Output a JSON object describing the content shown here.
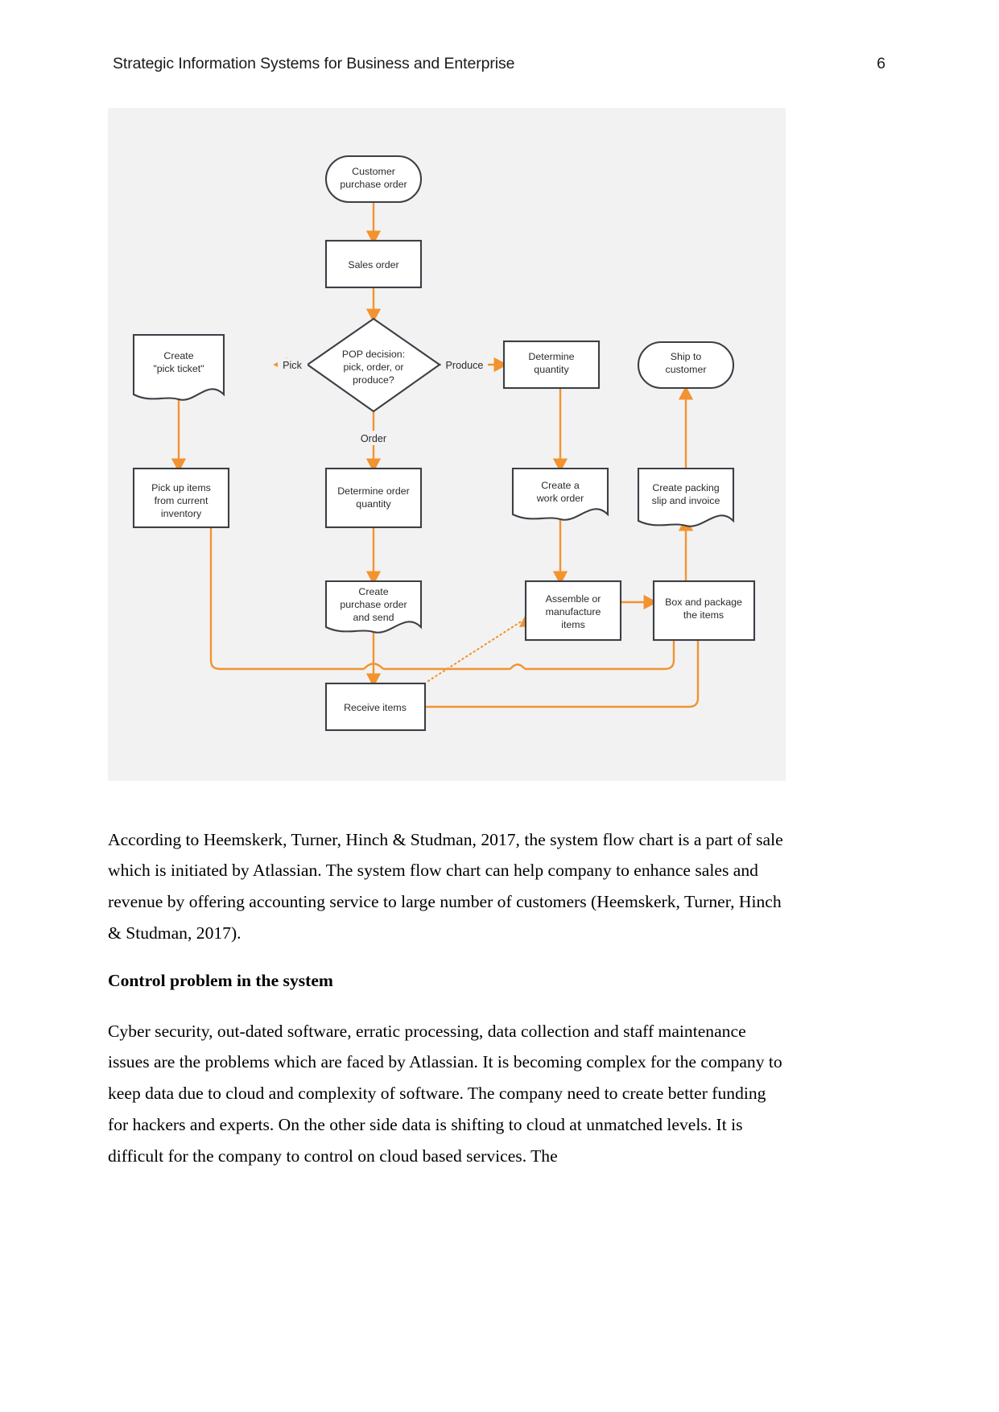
{
  "header": {
    "title": "Strategic Information Systems for Business and Enterprise",
    "page_number": "6"
  },
  "figure": {
    "name": "system-flow-chart",
    "background_color": "#f2f2f2",
    "accent_color": "#f29330",
    "shape_stroke_color": "#3c3f46"
  },
  "chart_data": {
    "type": "diagram",
    "diagram_kind": "flowchart",
    "title": "",
    "nodes": [
      {
        "id": "customer_purchase_order",
        "label": "Customer\npurchase order",
        "line1": "Customer",
        "line2": "purchase order",
        "shape": "terminator"
      },
      {
        "id": "sales_order",
        "label": "Sales order",
        "line1": "Sales order",
        "shape": "process"
      },
      {
        "id": "pop_decision",
        "label": "POP decision:\npick, order, or\nproduce?",
        "line1": "POP decision:",
        "line2": "pick, order, or",
        "line3": "produce?",
        "shape": "decision"
      },
      {
        "id": "create_pick_ticket",
        "label": "Create\n\"pick ticket\"",
        "line1": "Create",
        "line2": "\"pick ticket\"",
        "shape": "document"
      },
      {
        "id": "determine_quantity",
        "label": "Determine\nquantity",
        "line1": "Determine",
        "line2": "quantity",
        "shape": "process"
      },
      {
        "id": "ship_to_customer",
        "label": "Ship to\ncustomer",
        "line1": "Ship to",
        "line2": "customer",
        "shape": "terminator"
      },
      {
        "id": "pick_up_items",
        "label": "Pick up items\nfrom current\ninventory",
        "line1": "Pick up items",
        "line2": "from current",
        "line3": "inventory",
        "shape": "process"
      },
      {
        "id": "determine_order_quantity",
        "label": "Determine order\nquantity",
        "line1": "Determine order",
        "line2": "quantity",
        "shape": "process"
      },
      {
        "id": "create_work_order",
        "label": "Create a\nwork order",
        "line1": "Create a",
        "line2": "work order",
        "shape": "document"
      },
      {
        "id": "create_packing_slip",
        "label": "Create packing\nslip and invoice",
        "line1": "Create packing",
        "line2": "slip and invoice",
        "shape": "document"
      },
      {
        "id": "create_purchase_order",
        "label": "Create\npurchase order\nand send",
        "line1": "Create",
        "line2": "purchase order",
        "line3": "and send",
        "shape": "document"
      },
      {
        "id": "assemble_items",
        "label": "Assemble or\nmanufacture\nitems",
        "line1": "Assemble or",
        "line2": "manufacture",
        "line3": "items",
        "shape": "process"
      },
      {
        "id": "box_and_package",
        "label": "Box and package\nthe items",
        "line1": "Box and package",
        "line2": "the items",
        "shape": "process"
      },
      {
        "id": "receive_items",
        "label": "Receive items",
        "line1": "Receive items",
        "shape": "process"
      }
    ],
    "edge_labels": [
      {
        "id": "pick",
        "text": "Pick"
      },
      {
        "id": "produce",
        "text": "Produce"
      },
      {
        "id": "order",
        "text": "Order"
      }
    ],
    "edges": [
      {
        "from": "customer_purchase_order",
        "to": "sales_order",
        "label": ""
      },
      {
        "from": "sales_order",
        "to": "pop_decision",
        "label": ""
      },
      {
        "from": "pop_decision",
        "to": "create_pick_ticket",
        "label": "Pick"
      },
      {
        "from": "pop_decision",
        "to": "determine_quantity",
        "label": "Produce"
      },
      {
        "from": "pop_decision",
        "to": "determine_order_quantity",
        "label": "Order"
      },
      {
        "from": "create_pick_ticket",
        "to": "pick_up_items",
        "label": ""
      },
      {
        "from": "determine_quantity",
        "to": "create_work_order",
        "label": ""
      },
      {
        "from": "determine_order_quantity",
        "to": "create_purchase_order",
        "label": ""
      },
      {
        "from": "create_work_order",
        "to": "assemble_items",
        "label": ""
      },
      {
        "from": "create_purchase_order",
        "to": "receive_items",
        "label": ""
      },
      {
        "from": "receive_items",
        "to": "assemble_items",
        "label": "",
        "style": "dotted"
      },
      {
        "from": "pick_up_items",
        "to": "box_and_package",
        "label": ""
      },
      {
        "from": "receive_items",
        "to": "box_and_package",
        "label": ""
      },
      {
        "from": "assemble_items",
        "to": "box_and_package",
        "label": ""
      },
      {
        "from": "box_and_package",
        "to": "create_packing_slip",
        "label": ""
      },
      {
        "from": "create_packing_slip",
        "to": "ship_to_customer",
        "label": ""
      }
    ]
  },
  "body": {
    "paragraph_1": "According to Heemskerk, Turner, Hinch & Studman, 2017, the system flow chart is a part of sale which is initiated by Atlassian. The system flow chart can help company to enhance sales and revenue by offering accounting service to large number of customers (Heemskerk, Turner, Hinch & Studman, 2017).",
    "heading_control": "Control problem in the system",
    "paragraph_2": "Cyber security, out-dated software, erratic processing, data collection and staff maintenance issues are the problems which are faced by Atlassian. It is becoming complex for the company to keep data due to cloud and complexity of software. The company need to create better funding for hackers and experts. On the other side data is shifting to cloud at unmatched levels. It is difficult for the company to control on cloud based services. The"
  }
}
